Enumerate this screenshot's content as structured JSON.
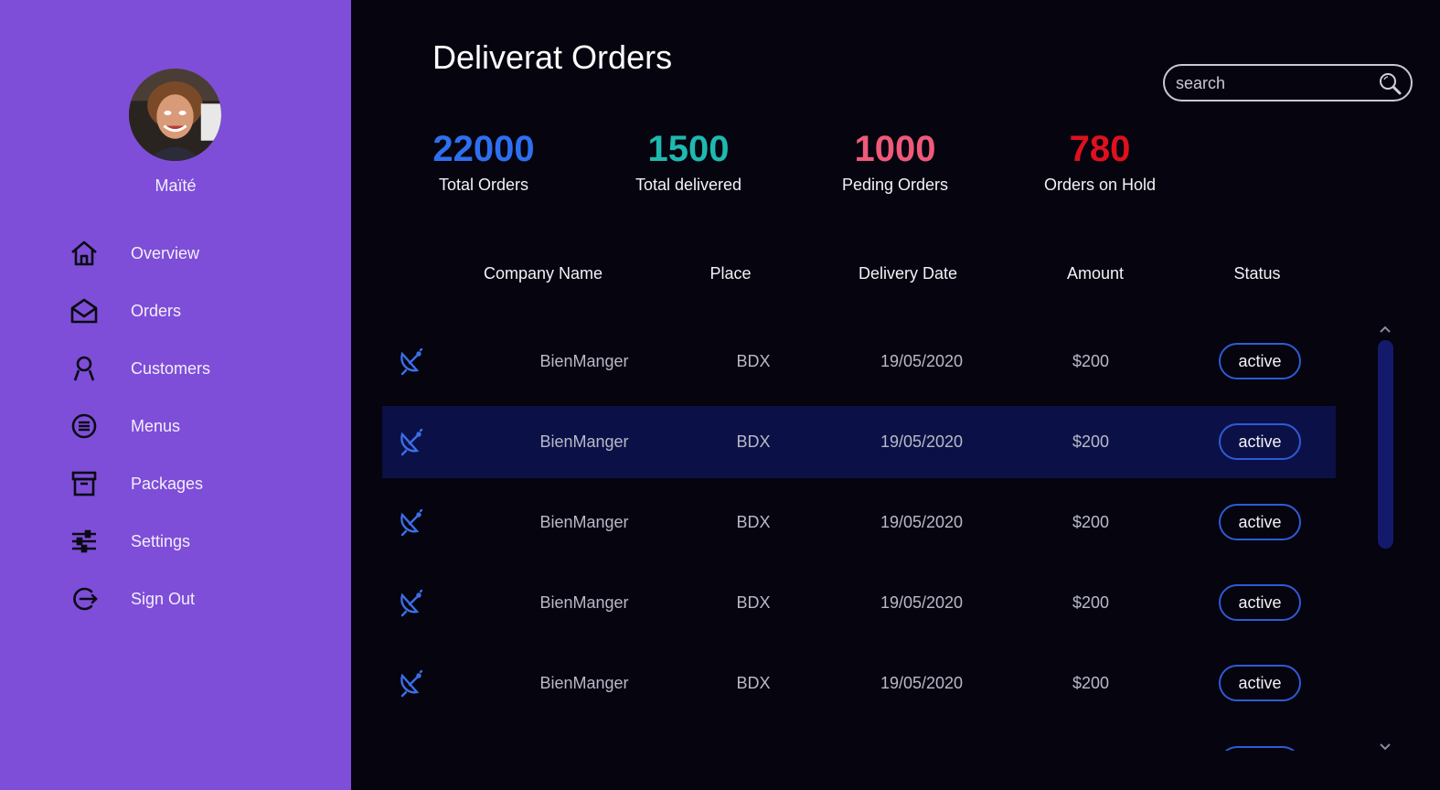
{
  "user": {
    "name": "Maïté"
  },
  "nav": [
    {
      "label": "Overview",
      "icon": "home-icon"
    },
    {
      "label": "Orders",
      "icon": "envelope-open-icon"
    },
    {
      "label": "Customers",
      "icon": "user-icon"
    },
    {
      "label": "Menus",
      "icon": "menu-circle-icon"
    },
    {
      "label": "Packages",
      "icon": "archive-box-icon"
    },
    {
      "label": "Settings",
      "icon": "sliders-icon"
    },
    {
      "label": "Sign Out",
      "icon": "sign-out-icon"
    }
  ],
  "header": {
    "title": "Deliverat Orders",
    "search_placeholder": "search"
  },
  "stats": [
    {
      "value": "22000",
      "label": "Total Orders",
      "color": "#2e6ff0"
    },
    {
      "value": "1500",
      "label": "Total delivered",
      "color": "#1fb9b0"
    },
    {
      "value": "1000",
      "label": "Peding Orders",
      "color": "#ef5a7a"
    },
    {
      "value": "780",
      "label": "Orders on Hold",
      "color": "#e0101e"
    }
  ],
  "table": {
    "columns": [
      "Company Name",
      "Place",
      "Delivery Date",
      "Amount",
      "Status"
    ],
    "rows": [
      {
        "company": "BienManger",
        "place": "BDX",
        "date": "19/05/2020",
        "amount": "$200",
        "status": "active",
        "icon": "satellite-dish-icon"
      },
      {
        "company": "BienManger",
        "place": "BDX",
        "date": "19/05/2020",
        "amount": "$200",
        "status": "active",
        "icon": "satellite-dish-icon"
      },
      {
        "company": "BienManger",
        "place": "BDX",
        "date": "19/05/2020",
        "amount": "$200",
        "status": "active",
        "icon": "satellite-dish-icon"
      },
      {
        "company": "BienManger",
        "place": "BDX",
        "date": "19/05/2020",
        "amount": "$200",
        "status": "active",
        "icon": "satellite-dish-icon"
      },
      {
        "company": "BienManger",
        "place": "BDX",
        "date": "19/05/2020",
        "amount": "$200",
        "status": "active",
        "icon": "satellite-dish-icon"
      }
    ],
    "selected_row": 2
  },
  "colors": {
    "sidebar": "#7e4ed8",
    "background": "#05040f",
    "accent": "#2e5bd6",
    "selected_row": "#0b1147"
  }
}
